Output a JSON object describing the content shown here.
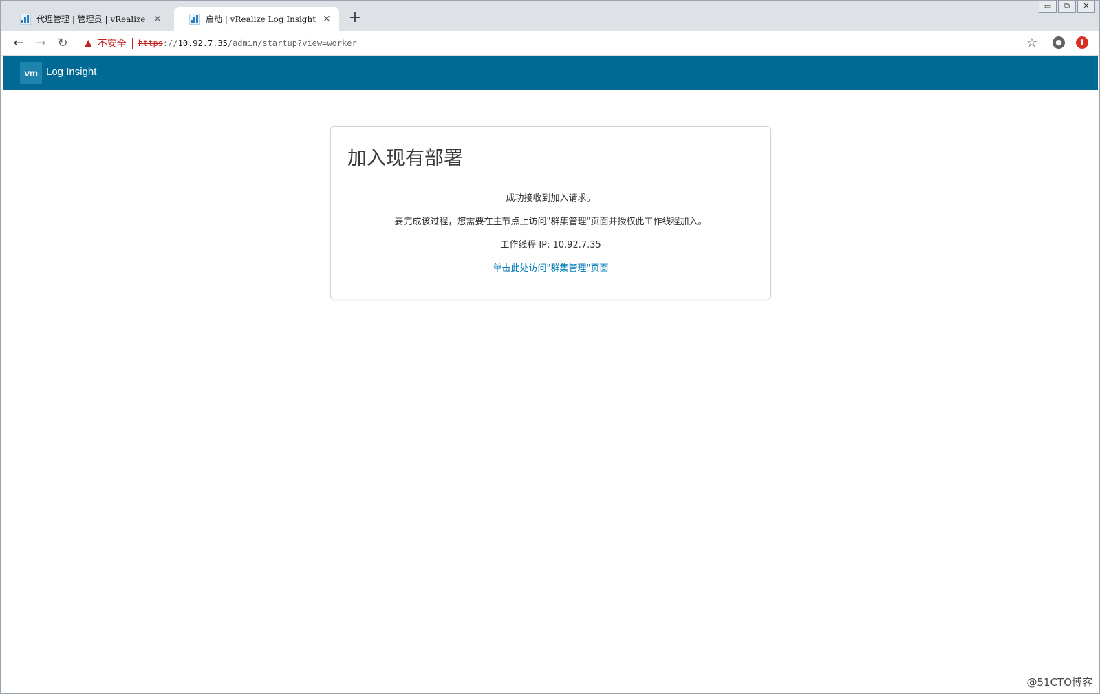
{
  "browser": {
    "tabs": [
      {
        "title": "代理管理 | 管理员 | vRealize",
        "active": false
      },
      {
        "title": "启动 | vRealize Log Insight",
        "active": true
      }
    ],
    "close_glyph": "✕",
    "new_tab_glyph": "+",
    "window_controls": {
      "minimize": "▭",
      "restore": "⧉",
      "close": "✕"
    },
    "nav": {
      "back": "←",
      "forward": "→",
      "reload": "↻"
    },
    "security": {
      "warning_glyph": "▲",
      "label": "不安全"
    },
    "url": {
      "scheme": "https",
      "sep": "://",
      "host": "10.92.7.35",
      "path": "/admin/startup?view=worker"
    },
    "star_glyph": "☆",
    "profile_glyph": "●",
    "extension_glyph": "⬆"
  },
  "app": {
    "logo_text": "vm",
    "name": "Log Insight",
    "header_color": "#006a95"
  },
  "card": {
    "title": "加入现有部署",
    "lines": [
      "成功接收到加入请求。",
      "要完成该过程，您需要在主节点上访问\"群集管理\"页面并授权此工作线程加入。",
      "工作线程 IP: 10.92.7.35"
    ],
    "link": "单击此处访问\"群集管理\"页面",
    "link_color": "#0079b8"
  },
  "watermark": "@51CTO博客"
}
